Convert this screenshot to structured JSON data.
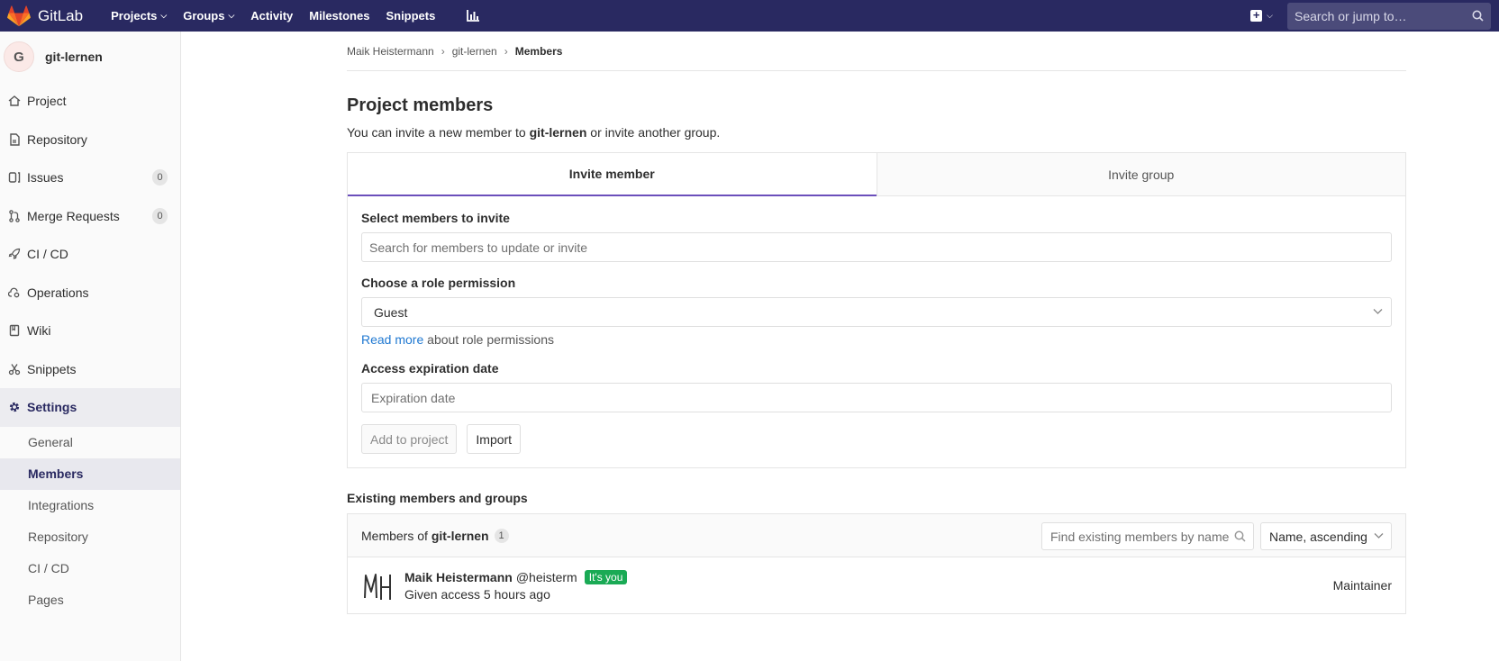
{
  "colors": {
    "topbar": "#292961",
    "accent_tab": "#6b4fbb",
    "link": "#1f78d1",
    "you_badge": "#1aaa55"
  },
  "topnav": {
    "brand": "GitLab",
    "items": [
      {
        "label": "Projects",
        "dropdown": true
      },
      {
        "label": "Groups",
        "dropdown": true
      },
      {
        "label": "Activity",
        "dropdown": false
      },
      {
        "label": "Milestones",
        "dropdown": false
      },
      {
        "label": "Snippets",
        "dropdown": false
      }
    ],
    "search_placeholder": "Search or jump to…",
    "icons": [
      "gitlab-logo-icon",
      "chart-icon",
      "plus-square-icon",
      "search-icon"
    ]
  },
  "sidebar": {
    "avatar_letter": "G",
    "project_name": "git-lernen",
    "items": [
      {
        "label": "Project",
        "icon": "home-icon"
      },
      {
        "label": "Repository",
        "icon": "doc-icon"
      },
      {
        "label": "Issues",
        "icon": "issues-icon",
        "badge": "0"
      },
      {
        "label": "Merge Requests",
        "icon": "merge-icon",
        "badge": "0"
      },
      {
        "label": "CI / CD",
        "icon": "rocket-icon"
      },
      {
        "label": "Operations",
        "icon": "cloud-gear-icon"
      },
      {
        "label": "Wiki",
        "icon": "book-icon"
      },
      {
        "label": "Snippets",
        "icon": "scissors-icon"
      },
      {
        "label": "Settings",
        "icon": "gear-icon",
        "active": true
      }
    ],
    "subitems": [
      {
        "label": "General"
      },
      {
        "label": "Members",
        "active": true
      },
      {
        "label": "Integrations"
      },
      {
        "label": "Repository"
      },
      {
        "label": "CI / CD"
      },
      {
        "label": "Pages"
      }
    ]
  },
  "breadcrumb": [
    "Maik Heistermann",
    "git-lernen",
    "Members"
  ],
  "page": {
    "title": "Project members",
    "subtitle_pre": "You can invite a new member to ",
    "subtitle_project": "git-lernen",
    "subtitle_post": " or invite another group."
  },
  "invite": {
    "tabs": [
      "Invite member",
      "Invite group"
    ],
    "select_label": "Select members to invite",
    "search_placeholder": "Search for members to update or invite",
    "role_label": "Choose a role permission",
    "role_value": "Guest",
    "read_more": "Read more",
    "read_more_suffix": " about role permissions",
    "expiry_label": "Access expiration date",
    "expiry_placeholder": "Expiration date",
    "add_button": "Add to project",
    "import_button": "Import"
  },
  "existing": {
    "title": "Existing members and groups",
    "header_prefix": "Members of ",
    "header_project": "git-lernen",
    "count": "1",
    "find_placeholder": "Find existing members by name",
    "sort_value": "Name, ascending",
    "members": [
      {
        "name": "Maik Heistermann",
        "handle": "@heisterm",
        "badge": "It's you",
        "access": "Given access 5 hours ago",
        "role": "Maintainer"
      }
    ]
  }
}
